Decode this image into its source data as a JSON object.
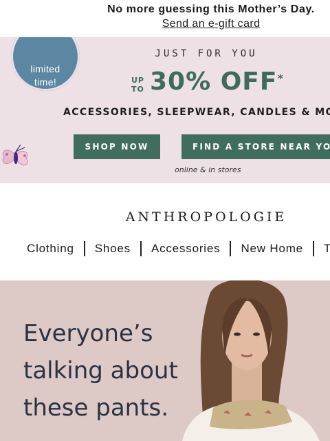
{
  "announcement": {
    "headline": "No more guessing this Mother’s Day.",
    "link": "Send an e-gift card"
  },
  "promo": {
    "badge": {
      "line1": "limited",
      "line2": "time!"
    },
    "eyebrow": "JUST FOR YOU",
    "up_to_line1": "UP",
    "up_to_line2": "TO",
    "discount": "30% OFF",
    "asterisk": "*",
    "categories": "ACCESSORIES, SLEEPWEAR, CANDLES & MO",
    "shop_now": "SHOP NOW",
    "find_store": "FIND A STORE NEAR YOU",
    "availability": "online & in stores",
    "colors": {
      "background": "#eee1e6",
      "accent": "#3f6e5f",
      "badge": "#5b87a3"
    }
  },
  "brand": {
    "name": "ANTHROPOLOGIE"
  },
  "nav": {
    "items": [
      {
        "label": "Clothing"
      },
      {
        "label": "Shoes"
      },
      {
        "label": "Accessories"
      },
      {
        "label": "New Home"
      },
      {
        "label": "T"
      }
    ]
  },
  "hero": {
    "headline_line1": "Everyone’s",
    "headline_line2": "talking about",
    "headline_line3": "these pants.",
    "colors": {
      "background": "#ddc9c6",
      "text": "#2a3344"
    }
  }
}
